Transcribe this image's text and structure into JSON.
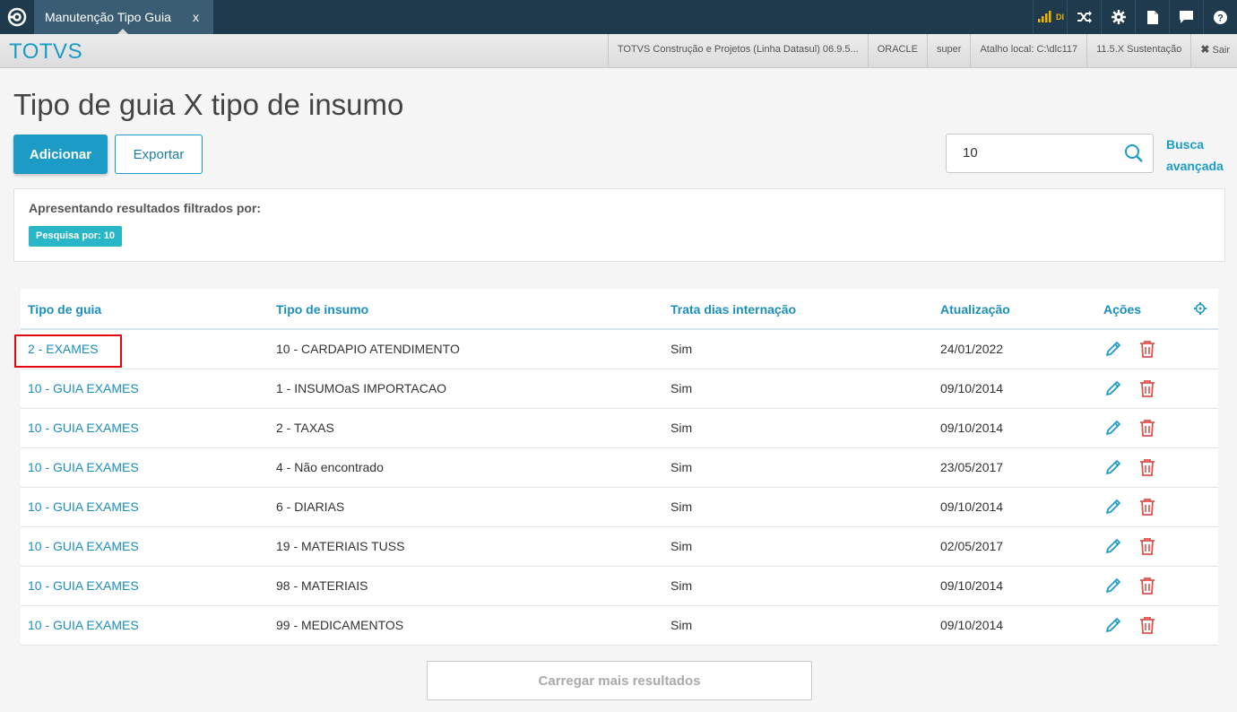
{
  "topbar": {
    "tab_title": "Manutenção Tipo Guia",
    "tab_close": "x",
    "signal_label": "DI",
    "icons": [
      "signal-icon",
      "shuffle-icon",
      "gear-icon",
      "document-icon",
      "chat-icon",
      "help-icon"
    ]
  },
  "subbar": {
    "brand": "TOTVS",
    "cells": [
      "TOTVS Construção e Projetos (Linha Datasul) 06.9.5...",
      "ORACLE",
      "super",
      "Atalho local: C:\\dlc117",
      "11.5.X Sustentação"
    ],
    "exit_label": "Sair"
  },
  "page": {
    "title": "Tipo de guia X tipo de insumo",
    "add_label": "Adicionar",
    "export_label": "Exportar",
    "search_value": "10",
    "advanced_line1": "Busca",
    "advanced_line2": "avançada"
  },
  "filter": {
    "label": "Apresentando resultados filtrados por:",
    "chip": "Pesquisa por: 10"
  },
  "table": {
    "headers": [
      "Tipo de guia",
      "Tipo de insumo",
      "Trata dias internação",
      "Atualização",
      "Ações"
    ],
    "rows": [
      [
        "2 - EXAMES",
        "10 - CARDAPIO ATENDIMENTO",
        "Sim",
        "24/01/2022"
      ],
      [
        "10 - GUIA EXAMES",
        "1 - INSUMOaS IMPORTACAO",
        "Sim",
        "09/10/2014"
      ],
      [
        "10 - GUIA EXAMES",
        "2 - TAXAS",
        "Sim",
        "09/10/2014"
      ],
      [
        "10 - GUIA EXAMES",
        "4 - Não encontrado",
        "Sim",
        "23/05/2017"
      ],
      [
        "10 - GUIA EXAMES",
        "6 - DIARIAS",
        "Sim",
        "09/10/2014"
      ],
      [
        "10 - GUIA EXAMES",
        "19 - MATERIAIS TUSS",
        "Sim",
        "02/05/2017"
      ],
      [
        "10 - GUIA EXAMES",
        "98 - MATERIAIS",
        "Sim",
        "09/10/2014"
      ],
      [
        "10 - GUIA EXAMES",
        "99 - MEDICAMENTOS",
        "Sim",
        "09/10/2014"
      ]
    ]
  },
  "load_more": "Carregar mais resultados",
  "colors": {
    "accent": "#1b9bc6",
    "delete": "#d9534f",
    "highlight": "#e30613",
    "topbar": "#1f3a4d"
  }
}
